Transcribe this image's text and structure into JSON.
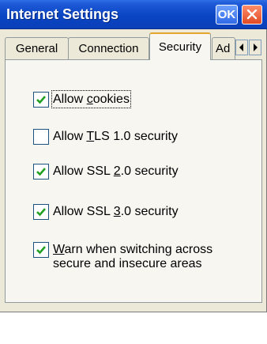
{
  "window": {
    "title": "Internet Settings",
    "ok_label": "OK"
  },
  "tabs": [
    {
      "label": "General",
      "active": false
    },
    {
      "label": "Connection",
      "active": false
    },
    {
      "label": "Security",
      "active": true
    },
    {
      "label": "Ad",
      "active": false
    }
  ],
  "options": [
    {
      "label_pre": "Allow ",
      "mnemonic": "c",
      "label_post": "ookies",
      "checked": true
    },
    {
      "label_pre": "Allow ",
      "mnemonic": "T",
      "label_post": "LS 1.0 security",
      "checked": false
    },
    {
      "label_pre": "Allow SSL ",
      "mnemonic": "2",
      "label_post": ".0 security",
      "checked": true
    },
    {
      "label_pre": "Allow SSL ",
      "mnemonic": "3",
      "label_post": ".0 security",
      "checked": true
    },
    {
      "label_pre": "",
      "mnemonic": "W",
      "label_post": "arn when switching across",
      "label_line2": "secure and insecure areas",
      "checked": true
    }
  ],
  "colors": {
    "title_bar": "#0a45c4",
    "checkmark": "#21a121",
    "active_tab_highlight": "#e6a52e"
  },
  "icons": {
    "close": "close-icon",
    "scroll_left": "arrow-left-icon",
    "scroll_right": "arrow-right-icon",
    "checkmark": "checkmark-icon"
  }
}
